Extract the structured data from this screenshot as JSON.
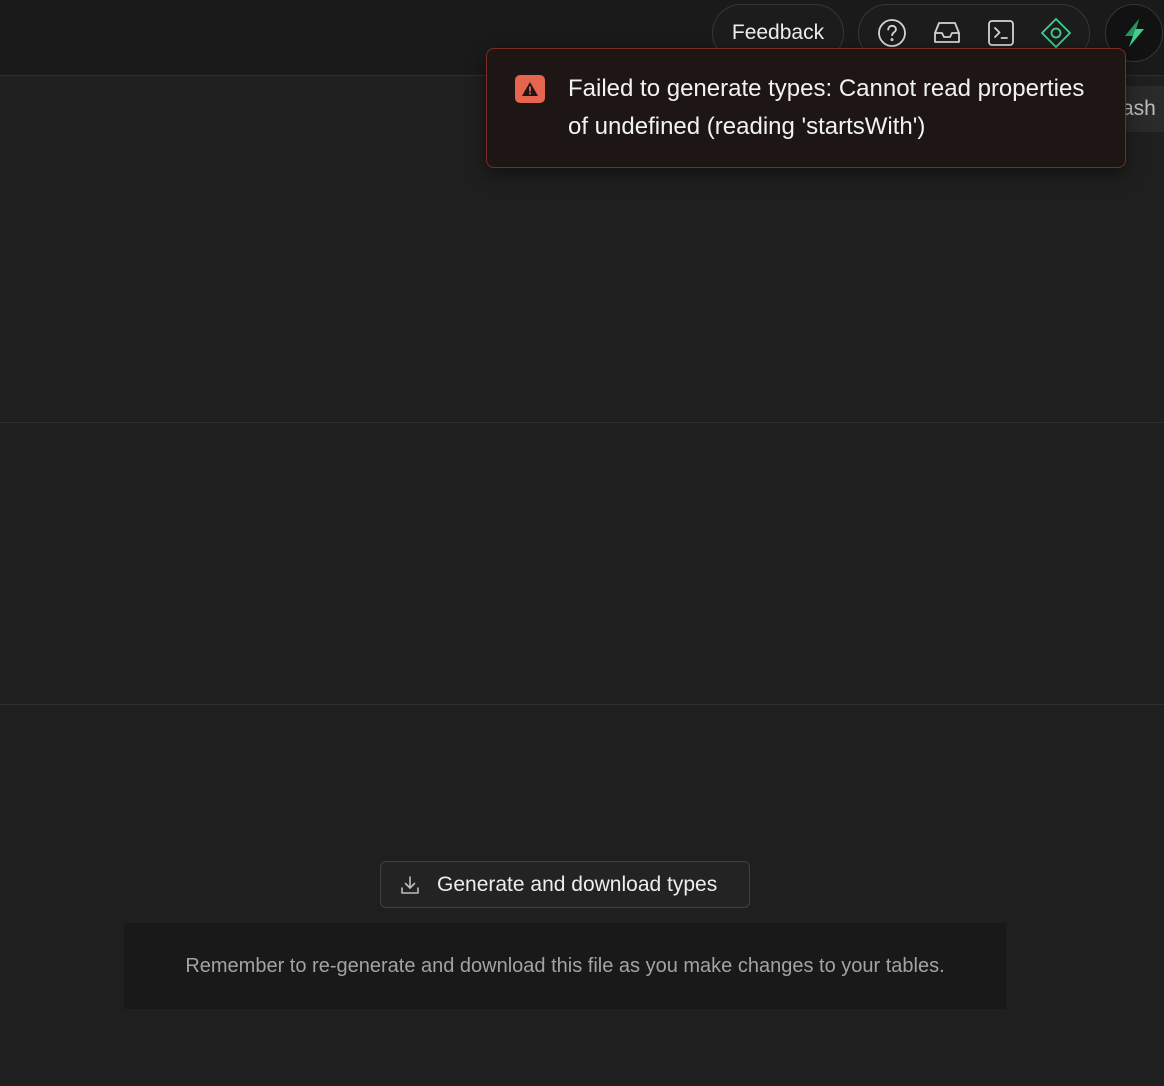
{
  "header": {
    "feedback_label": "Feedback",
    "icons": [
      "help-icon",
      "inbox-icon",
      "terminal-icon",
      "advisor-icon"
    ],
    "avatar_icon": "lightning-icon",
    "partial_button_label": "ash"
  },
  "toast": {
    "type": "error",
    "icon": "warning-icon",
    "message": "Failed to generate types: Cannot read properties of undefined (reading 'startsWith')"
  },
  "main": {
    "generate_button_label": "Generate and download types",
    "generate_button_icon": "download-icon",
    "note_text": "Remember to re-generate and download this file as you make changes to your tables."
  },
  "colors": {
    "background": "#1f1f1f",
    "error_accent": "#e5654f",
    "error_border": "#7c2c22",
    "brand_green": "#3ecf8e"
  }
}
